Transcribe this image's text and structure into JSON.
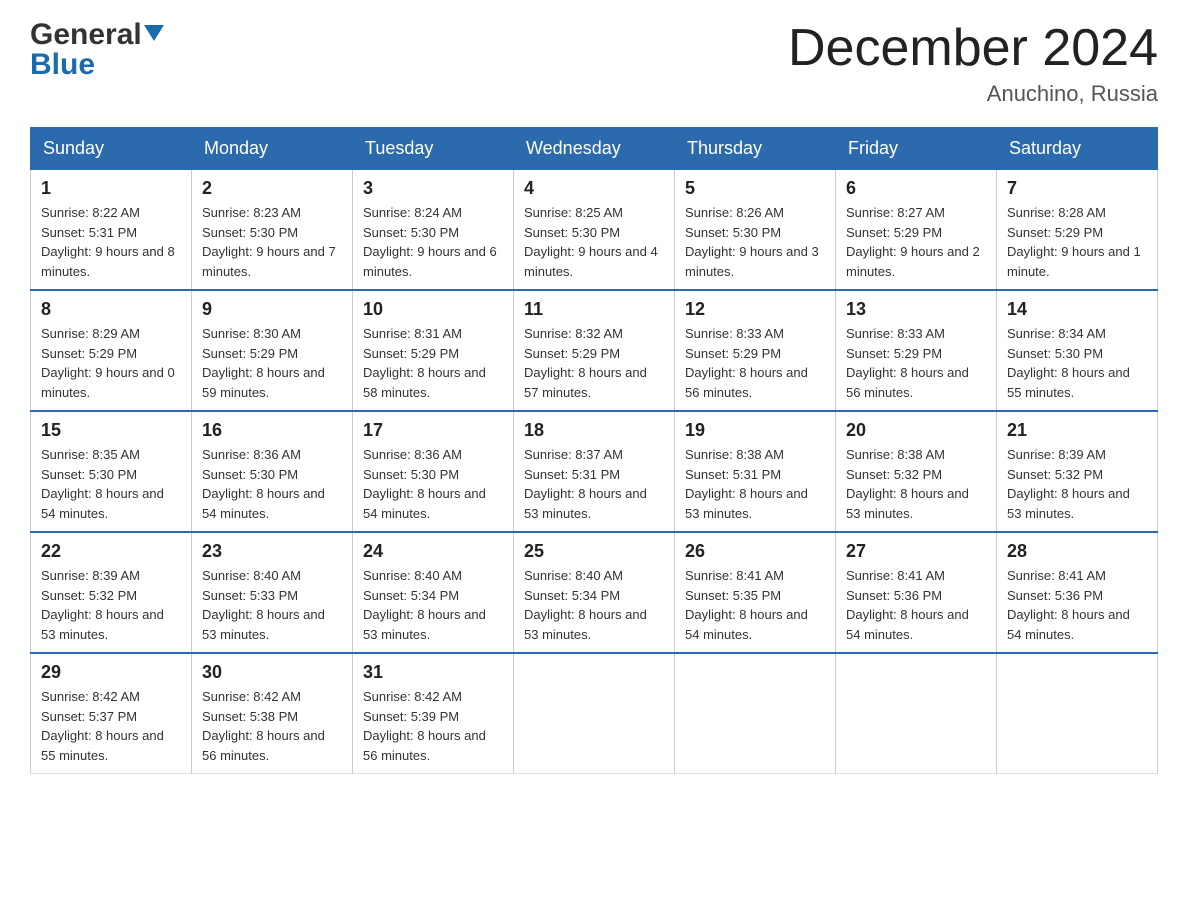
{
  "header": {
    "logo_general": "General",
    "logo_blue": "Blue",
    "month_title": "December 2024",
    "location": "Anuchino, Russia"
  },
  "days_of_week": [
    "Sunday",
    "Monday",
    "Tuesday",
    "Wednesday",
    "Thursday",
    "Friday",
    "Saturday"
  ],
  "weeks": [
    [
      {
        "day": "1",
        "sunrise": "8:22 AM",
        "sunset": "5:31 PM",
        "daylight": "9 hours and 8 minutes."
      },
      {
        "day": "2",
        "sunrise": "8:23 AM",
        "sunset": "5:30 PM",
        "daylight": "9 hours and 7 minutes."
      },
      {
        "day": "3",
        "sunrise": "8:24 AM",
        "sunset": "5:30 PM",
        "daylight": "9 hours and 6 minutes."
      },
      {
        "day": "4",
        "sunrise": "8:25 AM",
        "sunset": "5:30 PM",
        "daylight": "9 hours and 4 minutes."
      },
      {
        "day": "5",
        "sunrise": "8:26 AM",
        "sunset": "5:30 PM",
        "daylight": "9 hours and 3 minutes."
      },
      {
        "day": "6",
        "sunrise": "8:27 AM",
        "sunset": "5:29 PM",
        "daylight": "9 hours and 2 minutes."
      },
      {
        "day": "7",
        "sunrise": "8:28 AM",
        "sunset": "5:29 PM",
        "daylight": "9 hours and 1 minute."
      }
    ],
    [
      {
        "day": "8",
        "sunrise": "8:29 AM",
        "sunset": "5:29 PM",
        "daylight": "9 hours and 0 minutes."
      },
      {
        "day": "9",
        "sunrise": "8:30 AM",
        "sunset": "5:29 PM",
        "daylight": "8 hours and 59 minutes."
      },
      {
        "day": "10",
        "sunrise": "8:31 AM",
        "sunset": "5:29 PM",
        "daylight": "8 hours and 58 minutes."
      },
      {
        "day": "11",
        "sunrise": "8:32 AM",
        "sunset": "5:29 PM",
        "daylight": "8 hours and 57 minutes."
      },
      {
        "day": "12",
        "sunrise": "8:33 AM",
        "sunset": "5:29 PM",
        "daylight": "8 hours and 56 minutes."
      },
      {
        "day": "13",
        "sunrise": "8:33 AM",
        "sunset": "5:29 PM",
        "daylight": "8 hours and 56 minutes."
      },
      {
        "day": "14",
        "sunrise": "8:34 AM",
        "sunset": "5:30 PM",
        "daylight": "8 hours and 55 minutes."
      }
    ],
    [
      {
        "day": "15",
        "sunrise": "8:35 AM",
        "sunset": "5:30 PM",
        "daylight": "8 hours and 54 minutes."
      },
      {
        "day": "16",
        "sunrise": "8:36 AM",
        "sunset": "5:30 PM",
        "daylight": "8 hours and 54 minutes."
      },
      {
        "day": "17",
        "sunrise": "8:36 AM",
        "sunset": "5:30 PM",
        "daylight": "8 hours and 54 minutes."
      },
      {
        "day": "18",
        "sunrise": "8:37 AM",
        "sunset": "5:31 PM",
        "daylight": "8 hours and 53 minutes."
      },
      {
        "day": "19",
        "sunrise": "8:38 AM",
        "sunset": "5:31 PM",
        "daylight": "8 hours and 53 minutes."
      },
      {
        "day": "20",
        "sunrise": "8:38 AM",
        "sunset": "5:32 PM",
        "daylight": "8 hours and 53 minutes."
      },
      {
        "day": "21",
        "sunrise": "8:39 AM",
        "sunset": "5:32 PM",
        "daylight": "8 hours and 53 minutes."
      }
    ],
    [
      {
        "day": "22",
        "sunrise": "8:39 AM",
        "sunset": "5:32 PM",
        "daylight": "8 hours and 53 minutes."
      },
      {
        "day": "23",
        "sunrise": "8:40 AM",
        "sunset": "5:33 PM",
        "daylight": "8 hours and 53 minutes."
      },
      {
        "day": "24",
        "sunrise": "8:40 AM",
        "sunset": "5:34 PM",
        "daylight": "8 hours and 53 minutes."
      },
      {
        "day": "25",
        "sunrise": "8:40 AM",
        "sunset": "5:34 PM",
        "daylight": "8 hours and 53 minutes."
      },
      {
        "day": "26",
        "sunrise": "8:41 AM",
        "sunset": "5:35 PM",
        "daylight": "8 hours and 54 minutes."
      },
      {
        "day": "27",
        "sunrise": "8:41 AM",
        "sunset": "5:36 PM",
        "daylight": "8 hours and 54 minutes."
      },
      {
        "day": "28",
        "sunrise": "8:41 AM",
        "sunset": "5:36 PM",
        "daylight": "8 hours and 54 minutes."
      }
    ],
    [
      {
        "day": "29",
        "sunrise": "8:42 AM",
        "sunset": "5:37 PM",
        "daylight": "8 hours and 55 minutes."
      },
      {
        "day": "30",
        "sunrise": "8:42 AM",
        "sunset": "5:38 PM",
        "daylight": "8 hours and 56 minutes."
      },
      {
        "day": "31",
        "sunrise": "8:42 AM",
        "sunset": "5:39 PM",
        "daylight": "8 hours and 56 minutes."
      },
      null,
      null,
      null,
      null
    ]
  ],
  "labels": {
    "sunrise": "Sunrise:",
    "sunset": "Sunset:",
    "daylight": "Daylight:"
  }
}
